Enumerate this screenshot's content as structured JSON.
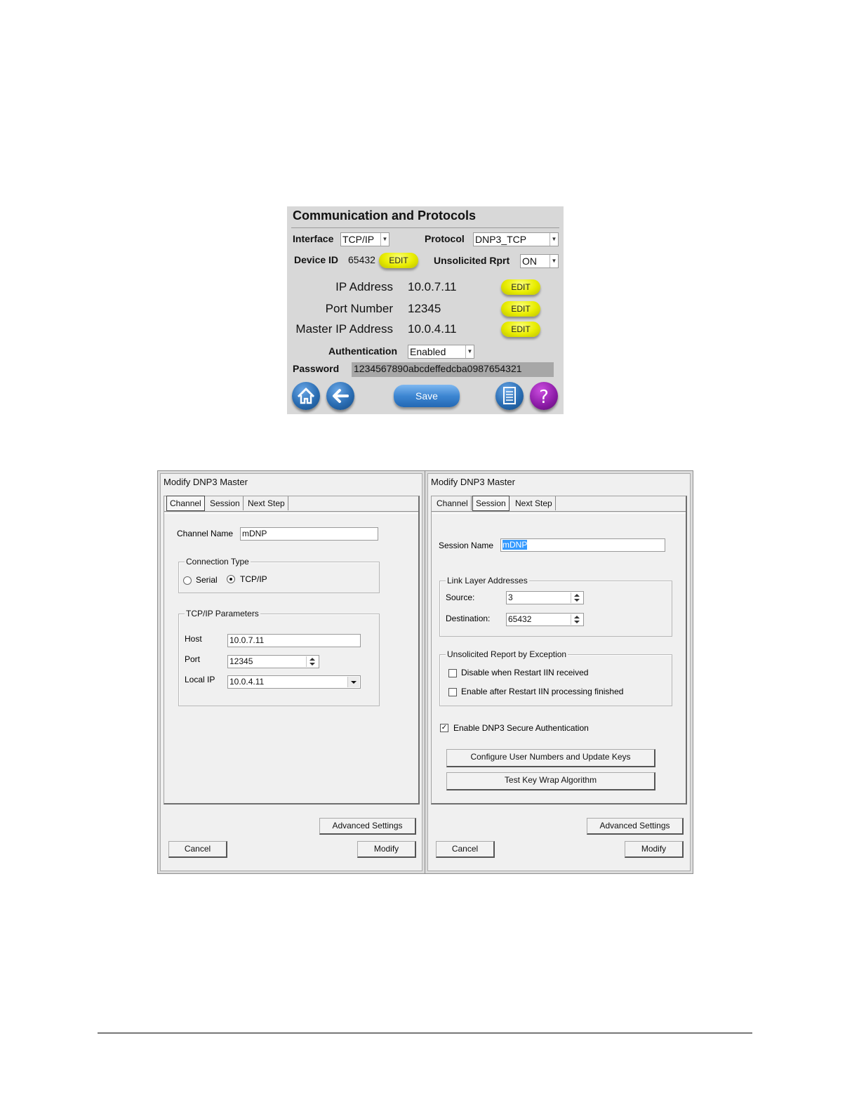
{
  "comm": {
    "title": "Communication and Protocols",
    "interface_label": "Interface",
    "interface_value": "TCP/IP",
    "protocol_label": "Protocol",
    "protocol_value": "DNP3_TCP",
    "device_id_label": "Device ID",
    "device_id_value": "65432",
    "unsolicited_label": "Unsolicited Rprt",
    "unsolicited_value": "ON",
    "edit_label": "EDIT",
    "ip_label": "IP Address",
    "ip_value": "10.0.7.11",
    "port_label": "Port Number",
    "port_value": "12345",
    "master_ip_label": "Master IP Address",
    "master_ip_value": "10.0.4.11",
    "auth_label": "Authentication",
    "auth_value": "Enabled",
    "password_label": "Password",
    "password_value": "1234567890abcdeffedcba0987654321",
    "save_label": "Save",
    "help_glyph": "?",
    "colors": {
      "edit": "#e8ec00",
      "save": "#3d86d2",
      "help": "#8a1aa5",
      "panel": "#d8d8d8"
    }
  },
  "dialog1": {
    "title": "Modify DNP3 Master",
    "tabs": [
      "Channel",
      "Session",
      "Next Step"
    ],
    "active_tab": "Channel",
    "channel_name_label": "Channel Name",
    "channel_name_value": "mDNP",
    "connection_type_label": "Connection Type",
    "serial_label": "Serial",
    "tcpip_label": "TCP/IP",
    "tcp_params_label": "TCP/IP Parameters",
    "host_label": "Host",
    "host_value": "10.0.7.11",
    "port_label": "Port",
    "port_value": "12345",
    "local_ip_label": "Local IP",
    "local_ip_value": "10.0.4.11",
    "advanced_label": "Advanced Settings",
    "cancel_label": "Cancel",
    "modify_label": "Modify"
  },
  "dialog2": {
    "title": "Modify DNP3 Master",
    "tabs": [
      "Channel",
      "Session",
      "Next Step"
    ],
    "active_tab": "Session",
    "session_name_label": "Session Name",
    "session_name_value": "mDNP",
    "link_layer_label": "Link Layer Addresses",
    "source_label": "Source:",
    "source_value": "3",
    "destination_label": "Destination:",
    "destination_value": "65432",
    "unsol_group_label": "Unsolicited Report by Exception",
    "disable_restart_label": "Disable when Restart IIN received",
    "enable_restart_label": "Enable after Restart IIN processing finished",
    "secure_auth_label": "Enable DNP3 Secure Authentication",
    "configure_keys_label": "Configure User Numbers and Update Keys",
    "test_key_label": "Test Key Wrap Algorithm",
    "advanced_label": "Advanced Settings",
    "cancel_label": "Cancel",
    "modify_label": "Modify"
  }
}
